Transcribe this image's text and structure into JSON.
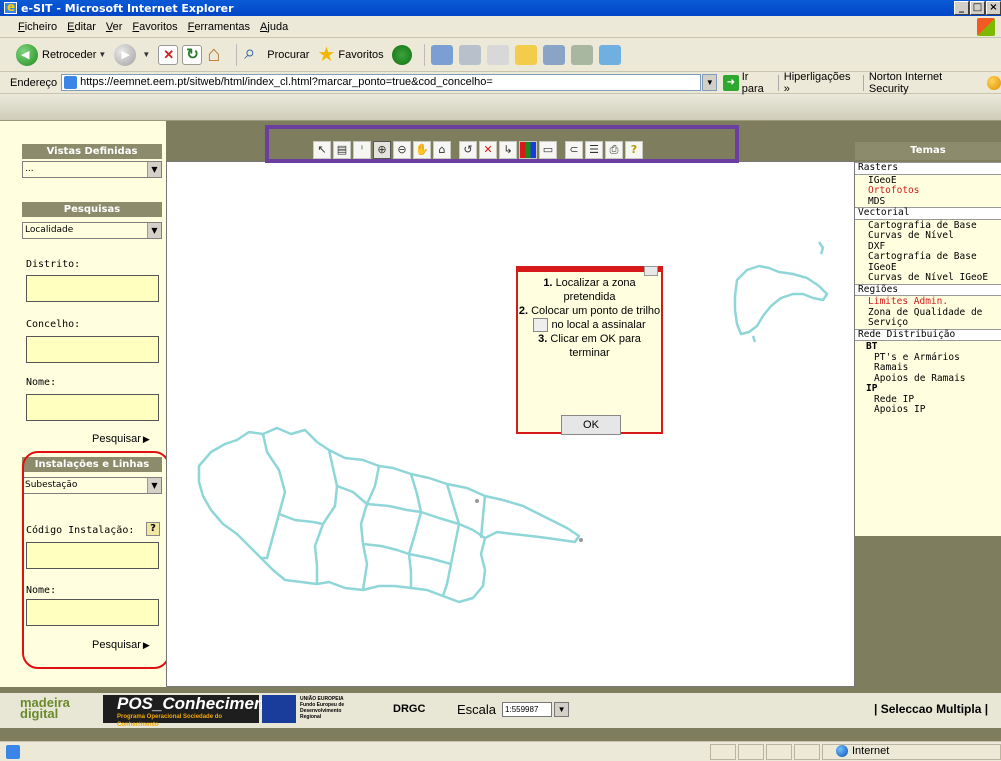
{
  "window": {
    "title": "e-SIT - Microsoft Internet Explorer",
    "minimize": "_",
    "maximize": "□",
    "close": "×"
  },
  "menu": [
    "Ficheiro",
    "Editar",
    "Ver",
    "Favoritos",
    "Ferramentas",
    "Ajuda"
  ],
  "toolbar": {
    "back_label": "Retroceder",
    "search_label": "Procurar",
    "favorites_label": "Favoritos"
  },
  "address": {
    "label": "Endereço",
    "url": "https://eemnet.eem.pt/sitweb/html/index_cl.html?marcar_ponto=true&cod_concelho=",
    "go_label": "Ir para",
    "links_label": "Hiperligações »",
    "norton_label": "Norton Internet Security"
  },
  "left": {
    "vistas_title": "Vistas Definidas",
    "vistas_value": "...",
    "pesquisas_title": "Pesquisas",
    "pesquisas_value": "Localidade",
    "distrito_label": "Distrito:",
    "concelho_label": "Concelho:",
    "nome_label": "Nome:",
    "pesquisar_label": "Pesquisar",
    "instalacoes_title": "Instalações e Linhas",
    "instalacoes_value": "Subestação",
    "codigo_label": "Código Instalação:",
    "codigo_help": "?",
    "nome2_label": "Nome:",
    "pesquisar2_label": "Pesquisar"
  },
  "map_tools": [
    "select-arrow",
    "select-info",
    "identify",
    "zoom-in",
    "zoom-out",
    "pan",
    "home",
    "mark-point",
    "delete-point",
    "route",
    "legend-colors",
    "measure",
    "clear",
    "list",
    "print",
    "help"
  ],
  "popup": {
    "step1_num": "1.",
    "step1_text": "Localizar a zona pretendida",
    "step2_num": "2.",
    "step2_text_a": "Colocar um ponto de trilho",
    "step2_text_b": "no local a assinalar",
    "step3_num": "3.",
    "step3_text": "Clicar em OK para terminar",
    "ok_label": "OK"
  },
  "temas": {
    "title": "Temas",
    "rasters": "Rasters",
    "rasters_items": [
      "IGeoE",
      "Ortofotos",
      "MDS"
    ],
    "vectorial": "Vectorial",
    "vectorial_items": [
      "Cartografia de Base",
      "Curvas de Nível",
      "DXF",
      "Cartografia de Base IGeoE",
      "Curvas de Nível IGeoE"
    ],
    "regioes": "Regiões",
    "regioes_items": [
      "Limites Admin.",
      "Zona de Qualidade de Serviço"
    ],
    "rede": "Rede Distribuição",
    "bt": "BT",
    "bt_items": [
      "PT's e Armários",
      "Ramais",
      "Apoios de Ramais"
    ],
    "ip": "IP",
    "ip_items": [
      "Rede IP",
      "Apoios IP"
    ]
  },
  "footer": {
    "logo1": "madeira digital",
    "logo2_main": "POS_Conhecimento",
    "logo2_sub": "Programa Operacional Sociedade do Conhecimento",
    "logo3_text": "UNIÃO EUROPEIA Fundo Europeu de Desenvolvimento Regional",
    "drgc": "DRGC",
    "escala_label": "Escala",
    "escala_value": "1:559987",
    "seleccao": "| Seleccao Multipla |"
  },
  "status": {
    "zone": "Internet"
  }
}
